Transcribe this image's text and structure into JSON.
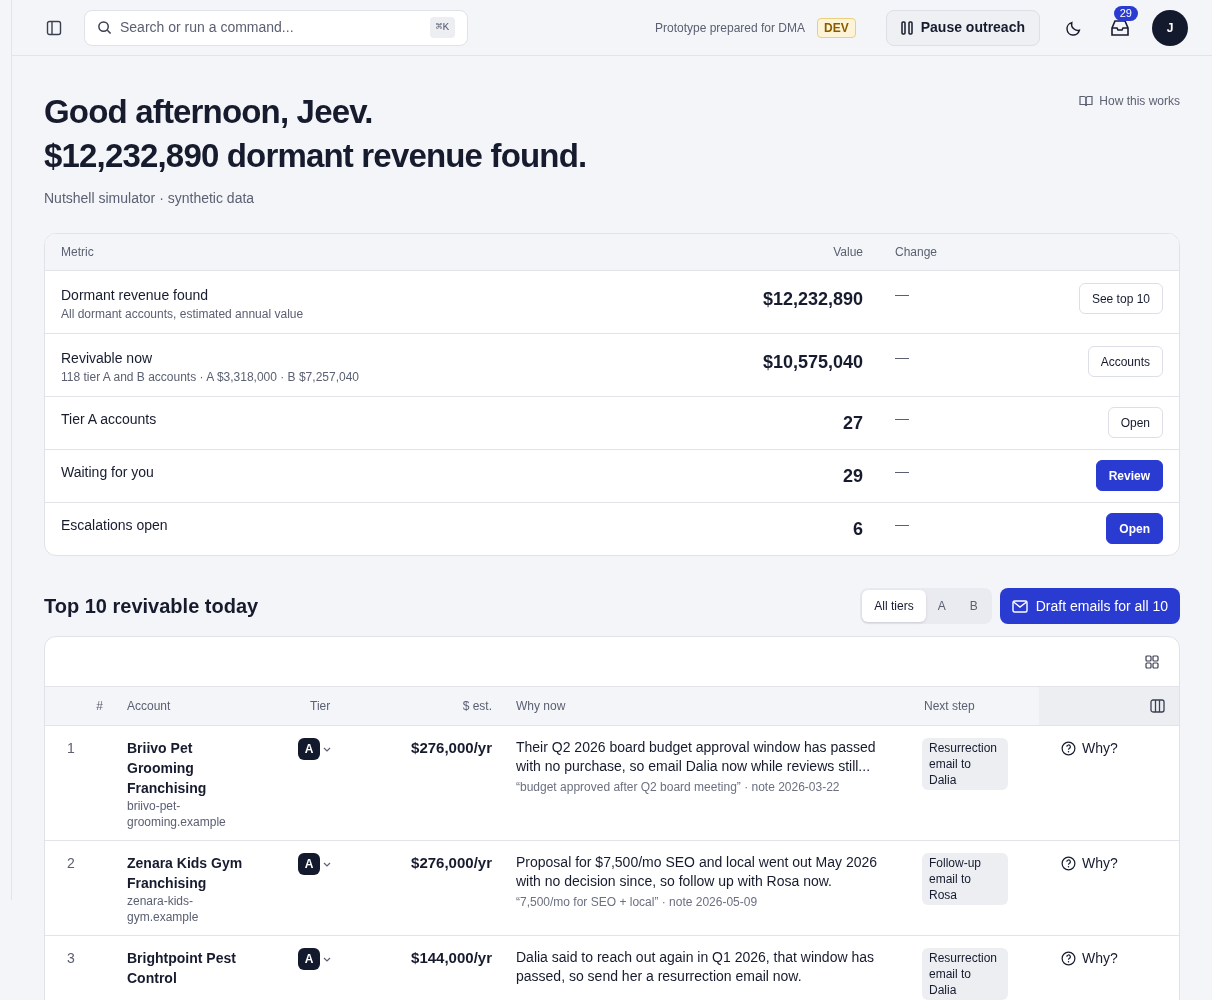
{
  "topbar": {
    "search": {
      "placeholder": "Search or run a command...",
      "shortcut": "⌘K"
    },
    "prototype_note": "Prototype prepared for DMA",
    "env_badge": "DEV",
    "pause_button": "Pause outreach",
    "notifications_count": "29",
    "avatar_initial": "J"
  },
  "greeting": "Good afternoon, Jeev.",
  "headline": "$12,232,890 dormant revenue found.",
  "subtitle": "Nutshell simulator · synthetic data",
  "help_link": "How this works",
  "metrics": {
    "columns": [
      "Metric",
      "Value",
      "Change"
    ],
    "rows": [
      {
        "label": "Dormant revenue found",
        "detail": "All dormant accounts, estimated annual value",
        "value": "$12,232,890",
        "change": "—",
        "action": "See top 10",
        "primary": false
      },
      {
        "label": "Revivable now",
        "detail": "118 tier A and B accounts · A $3,318,000 · B $7,257,040",
        "value": "$10,575,040",
        "change": "—",
        "action": "Accounts",
        "primary": false
      },
      {
        "label": "Tier A accounts",
        "value": "27",
        "change": "—",
        "action": "Open",
        "primary": false
      },
      {
        "label": "Waiting for you",
        "value": "29",
        "change": "—",
        "action": "Review",
        "primary": true
      },
      {
        "label": "Escalations open",
        "value": "6",
        "change": "—",
        "action": "Open",
        "primary": true
      }
    ]
  },
  "top10": {
    "title": "Top 10 revivable today",
    "filters": [
      {
        "label": "All tiers",
        "selected": true
      },
      {
        "label": "A",
        "selected": false
      },
      {
        "label": "B",
        "selected": false
      }
    ],
    "draft_button": "Draft emails for all 10",
    "columns": [
      "#",
      "Account",
      "Tier",
      "$ est.",
      "Why now",
      "Next step"
    ],
    "rows": [
      {
        "rank": "1",
        "name": "Briivo Pet Grooming Franchising",
        "domain": "briivo-pet-grooming.example",
        "tier": "A",
        "estimate": "$276,000/yr",
        "why": "Their Q2 2026 board budget approval window has passed with no purchase, so email Dalia now while reviews still...",
        "quote": "“budget approved after Q2 board meeting” · note 2026-03-22",
        "next_step": "Resurrection email to Dalia",
        "why_button": "Why?"
      },
      {
        "rank": "2",
        "name": "Zenara Kids Gym Franchising",
        "domain": "zenara-kids-gym.example",
        "tier": "A",
        "estimate": "$276,000/yr",
        "why": "Proposal for $7,500/mo SEO and local went out May 2026 with no decision since, so follow up with Rosa now.",
        "quote": "“7,500/mo for SEO + local” · note 2026-05-09",
        "next_step": "Follow-up email to Rosa",
        "why_button": "Why?"
      },
      {
        "rank": "3",
        "name": "Brightpoint Pest Control",
        "tier": "A",
        "estimate": "$144,000/yr",
        "why": "Dalia said to reach out again in Q1 2026, that window has passed, so send her a resurrection email now.",
        "next_step": "Resurrection email to Dalia",
        "why_button": "Why?"
      }
    ]
  }
}
